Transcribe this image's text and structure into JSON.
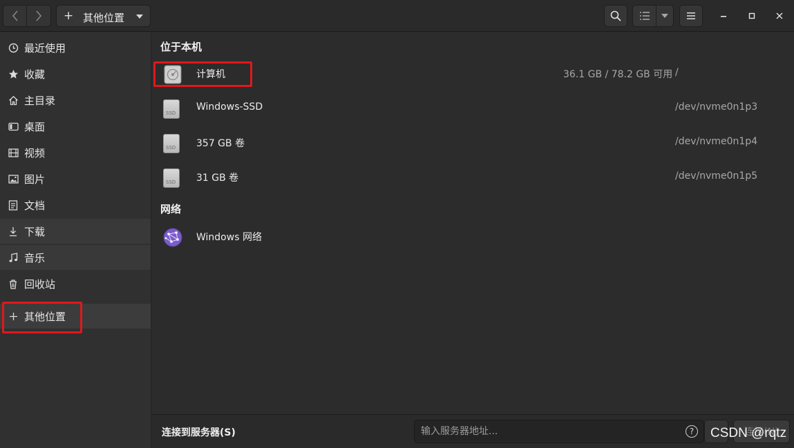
{
  "header": {
    "location_label": "其他位置",
    "icons": {
      "back": "chevron-left-icon",
      "forward": "chevron-right-icon",
      "search": "search-icon",
      "list_view": "list-view-icon",
      "menu": "hamburger-menu-icon",
      "minimize": "minimize-icon",
      "maximize": "maximize-icon",
      "close": "close-icon"
    }
  },
  "sidebar": {
    "items": [
      {
        "label": "最近使用",
        "icon": "clock-icon"
      },
      {
        "label": "收藏",
        "icon": "star-icon"
      },
      {
        "label": "主目录",
        "icon": "home-icon"
      },
      {
        "label": "桌面",
        "icon": "desktop-icon"
      },
      {
        "label": "视频",
        "icon": "video-icon"
      },
      {
        "label": "图片",
        "icon": "image-icon"
      },
      {
        "label": "文档",
        "icon": "document-icon"
      },
      {
        "label": "下载",
        "icon": "download-icon"
      },
      {
        "label": "音乐",
        "icon": "music-icon"
      },
      {
        "label": "回收站",
        "icon": "trash-icon"
      },
      {
        "label": "其他位置",
        "icon": "plus-icon"
      }
    ]
  },
  "main": {
    "sections": {
      "local": "位于本机",
      "network": "网络"
    },
    "local_items": [
      {
        "name": "计算机",
        "usage": "36.1 GB / 78.2 GB 可用",
        "path": "/",
        "icon": "computer-disk-icon"
      },
      {
        "name": "Windows-SSD",
        "usage": "",
        "path": "/dev/nvme0n1p3",
        "icon": "ssd-drive-icon"
      },
      {
        "name": "357 GB 卷",
        "usage": "",
        "path": "/dev/nvme0n1p4",
        "icon": "ssd-drive-icon"
      },
      {
        "name": "31 GB 卷",
        "usage": "",
        "path": "/dev/nvme0n1p5",
        "icon": "ssd-drive-icon"
      }
    ],
    "ssd_badge": "SSD",
    "network_items": [
      {
        "name": "Windows 网络",
        "icon": "network-globe-icon"
      }
    ]
  },
  "bottom": {
    "title": "连接到服务器(S)",
    "placeholder": "输入服务器地址...",
    "help": "?",
    "connect_label": "连接(N)"
  },
  "watermark": "CSDN @rqtz",
  "colors": {
    "highlight_box": "#e0181b",
    "background": "#2c2c2c",
    "sidebar": "#303030"
  }
}
